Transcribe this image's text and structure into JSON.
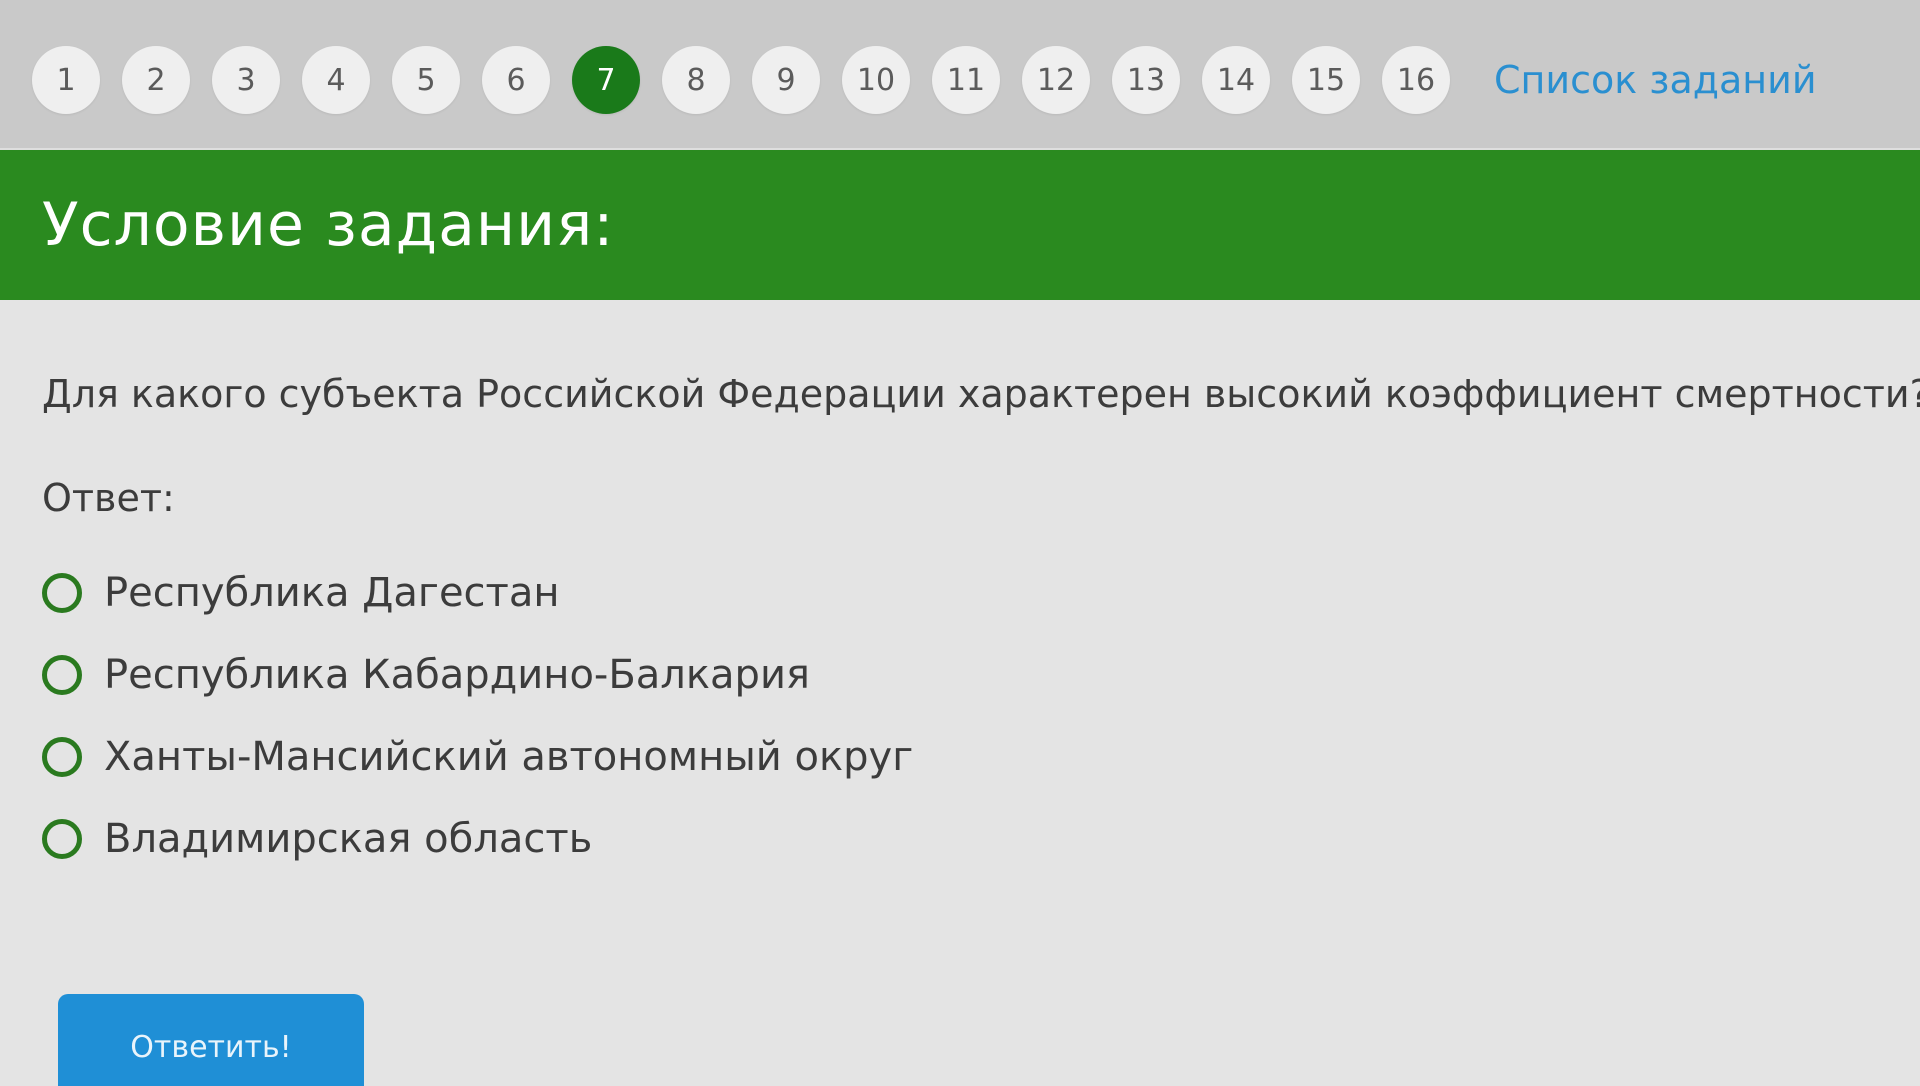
{
  "task_nav": {
    "tasks": [
      "1",
      "2",
      "3",
      "4",
      "5",
      "6",
      "7",
      "8",
      "9",
      "10",
      "11",
      "12",
      "13",
      "14",
      "15",
      "16"
    ],
    "current": "7",
    "list_link": "Список заданий"
  },
  "banner": {
    "title": "Условие задания:"
  },
  "question": {
    "text": "Для какого субъекта Российской Федерации характерен высокий коэффициент смертности?"
  },
  "answer": {
    "label": "Ответ:",
    "options": [
      "Республика Дагестан",
      "Республика Кабардино-Балкария",
      "Ханты-Мансийский автономный округ",
      "Владимирская область"
    ]
  },
  "submit": {
    "label": "Ответить!"
  },
  "colors": {
    "accent_green": "#2a8a1f",
    "current_task_green": "#1a7a1a",
    "link_blue": "#2a8fd0",
    "button_blue": "#1f8fd6"
  }
}
